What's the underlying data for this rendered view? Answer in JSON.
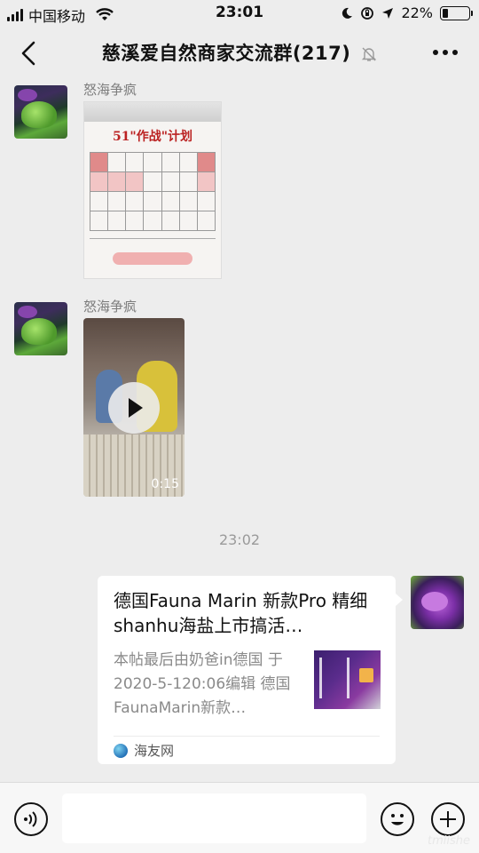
{
  "status_bar": {
    "carrier": "中国移动",
    "time": "23:01",
    "battery": "22%",
    "battery_level": 0.22,
    "icons": [
      "signal-icon",
      "wifi-icon",
      "moon-icon",
      "lock-rotation-icon",
      "location-icon",
      "battery-icon"
    ]
  },
  "nav": {
    "title": "慈溪爱自然商家交流群(217)",
    "back_icon": "chevron-left-icon",
    "mute_icon": "bell-off-icon",
    "more_icon": "more-dots-icon"
  },
  "messages": [
    {
      "sender": "怒海争疯",
      "type": "image",
      "image_text": "51\"作战\"计划"
    },
    {
      "sender": "怒海争疯",
      "type": "video",
      "duration": "0:15"
    }
  ],
  "time_separator": "23:02",
  "link_card": {
    "title": "德国Fauna Marin 新款Pro 精细shanhu海盐上市搞活…",
    "description": "本帖最后由奶爸in德国 于2020-5-120:06编辑 德国FaunaMarin新款…",
    "source": "海友网"
  },
  "input_bar": {
    "voice_icon": "voice-icon",
    "emoji_icon": "emoji-icon",
    "plus_icon": "plus-circle-icon",
    "input_value": ""
  },
  "watermark": "tmiishe"
}
